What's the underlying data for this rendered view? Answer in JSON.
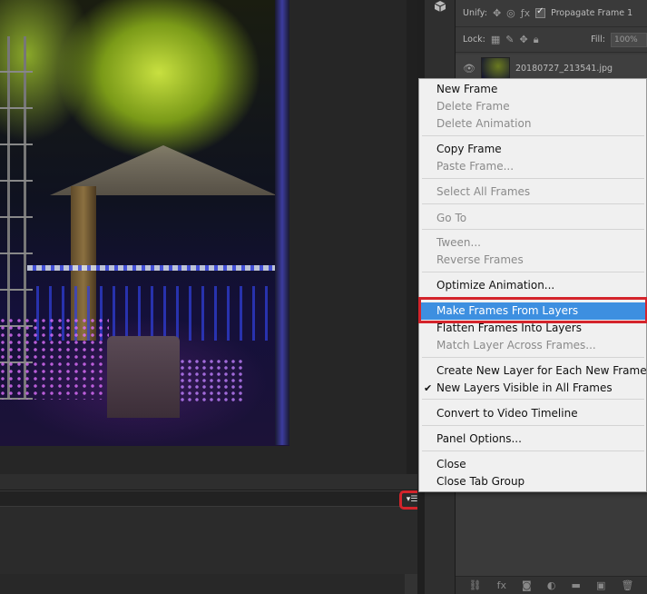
{
  "layers_panel": {
    "unify_label": "Unify:",
    "propagate_label": "Propagate Frame 1",
    "lock_label": "Lock:",
    "fill_label": "Fill:",
    "fill_value": "100%",
    "layer_name": "20180727_213541.jpg"
  },
  "context_menu": {
    "items": [
      {
        "label": "New Frame",
        "enabled": true
      },
      {
        "label": "Delete Frame",
        "enabled": false
      },
      {
        "label": "Delete Animation",
        "enabled": false
      },
      {
        "label": "Copy Frame",
        "enabled": true
      },
      {
        "label": "Paste Frame...",
        "enabled": false
      },
      {
        "label": "Select All Frames",
        "enabled": false
      },
      {
        "label": "Go To",
        "enabled": false
      },
      {
        "label": "Tween...",
        "enabled": false
      },
      {
        "label": "Reverse Frames",
        "enabled": false
      },
      {
        "label": "Optimize Animation...",
        "enabled": true
      },
      {
        "label": "Make Frames From Layers",
        "enabled": true,
        "highlighted": true
      },
      {
        "label": "Flatten Frames Into Layers",
        "enabled": true
      },
      {
        "label": "Match Layer Across Frames...",
        "enabled": false
      },
      {
        "label": "Create New Layer for Each New Frame",
        "enabled": true
      },
      {
        "label": "New Layers Visible in All Frames",
        "enabled": true,
        "checked": true
      },
      {
        "label": "Convert to Video Timeline",
        "enabled": true
      },
      {
        "label": "Panel Options...",
        "enabled": true
      },
      {
        "label": "Close",
        "enabled": true
      },
      {
        "label": "Close Tab Group",
        "enabled": true
      }
    ],
    "check_glyph": "✔"
  },
  "timeline": {
    "panel_menu_icon": "panel-menu-icon"
  },
  "colors": {
    "highlight": "#3d8fe0",
    "annotation_red": "#d4242b",
    "menu_bg": "#f0f0f0"
  }
}
